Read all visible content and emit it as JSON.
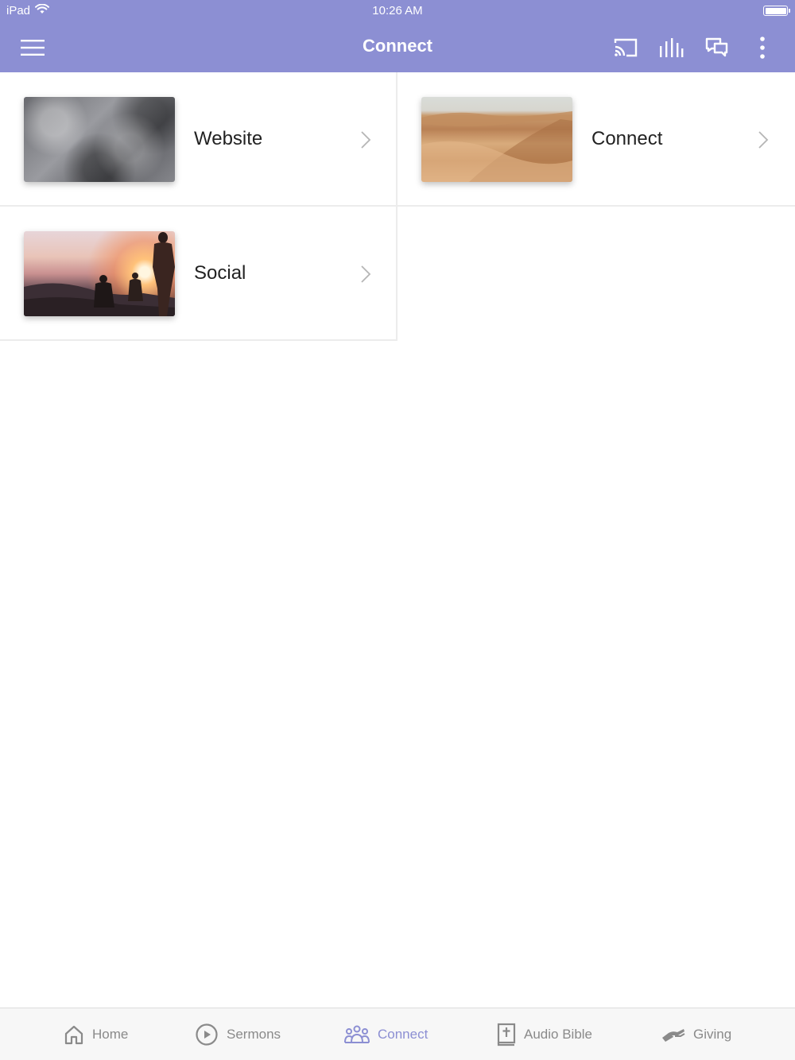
{
  "status_bar": {
    "carrier": "iPad",
    "time": "10:26 AM"
  },
  "header": {
    "title": "Connect"
  },
  "icons": {
    "menu": "menu-icon",
    "cast": "cast-icon",
    "equalizer": "equalizer-icon",
    "chat": "chat-icon",
    "more": "more-vertical-icon"
  },
  "items": [
    {
      "label": "Website",
      "thumb": "marble-texture"
    },
    {
      "label": "Connect",
      "thumb": "desert-dunes"
    },
    {
      "label": "Social",
      "thumb": "sunset-hikers"
    }
  ],
  "tabs": [
    {
      "label": "Home",
      "icon": "home-icon",
      "active": false
    },
    {
      "label": "Sermons",
      "icon": "play-circle-icon",
      "active": false
    },
    {
      "label": "Connect",
      "icon": "people-icon",
      "active": true
    },
    {
      "label": "Audio Bible",
      "icon": "bible-icon",
      "active": false
    },
    {
      "label": "Giving",
      "icon": "giving-hand-icon",
      "active": false
    }
  ],
  "colors": {
    "accent": "#8c8fd3",
    "tab_inactive": "#8a8a8a",
    "divider": "#ececec"
  }
}
